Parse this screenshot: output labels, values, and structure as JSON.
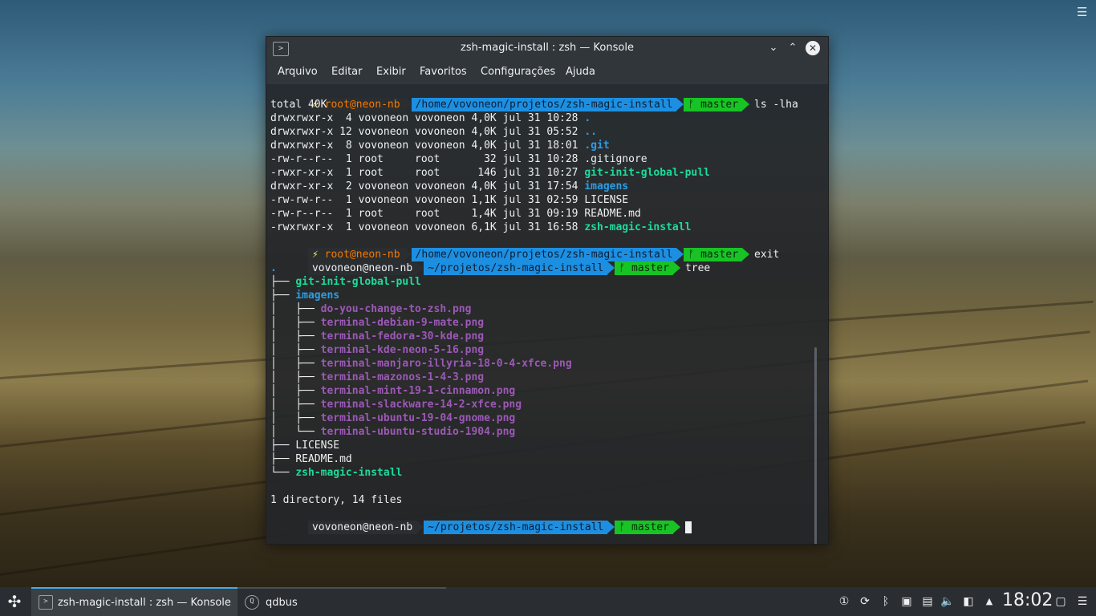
{
  "desktop": {
    "menu_icon": "hamburger-icon"
  },
  "window": {
    "title": "zsh-magic-install : zsh — Konsole",
    "icon": "terminal-icon",
    "controls": {
      "minimize": "⌄",
      "maximize": "⌃",
      "close": "✕"
    },
    "menu": [
      "Arquivo",
      "Editar",
      "Exibir",
      "Favoritos",
      "Configurações",
      "Ajuda"
    ]
  },
  "terminal": {
    "prompt1": {
      "bolt": "⚡",
      "user": "root@neon-nb",
      "path": "/home/vovoneon/projetos/zsh-magic-install",
      "git": "ᚠ master",
      "command": "ls -lha"
    },
    "total": "total 40K",
    "ls_rows": [
      {
        "meta": "drwxrwxr-x  4 vovoneon vovoneon 4,0K jul 31 10:28 ",
        "name": ".",
        "style": "blue"
      },
      {
        "meta": "drwxrwxr-x 12 vovoneon vovoneon 4,0K jul 31 05:52 ",
        "name": "..",
        "style": "blue"
      },
      {
        "meta": "drwxrwxr-x  8 vovoneon vovoneon 4,0K jul 31 18:01 ",
        "name": ".git",
        "style": "blue"
      },
      {
        "meta": "-rw-r--r--  1 root     root       32 jul 31 10:28 ",
        "name": ".gitignore",
        "style": "white"
      },
      {
        "meta": "-rwxr-xr-x  1 root     root      146 jul 31 10:27 ",
        "name": "git-init-global-pull",
        "style": "green"
      },
      {
        "meta": "drwxr-xr-x  2 vovoneon vovoneon 4,0K jul 31 17:54 ",
        "name": "imagens",
        "style": "blue"
      },
      {
        "meta": "-rw-rw-r--  1 vovoneon vovoneon 1,1K jul 31 02:59 ",
        "name": "LICENSE",
        "style": "white"
      },
      {
        "meta": "-rw-r--r--  1 root     root     1,4K jul 31 09:19 ",
        "name": "README.md",
        "style": "white"
      },
      {
        "meta": "-rwxrwxr-x  1 vovoneon vovoneon 6,1K jul 31 16:58 ",
        "name": "zsh-magic-install",
        "style": "green"
      }
    ],
    "prompt2": {
      "bolt": "⚡",
      "user": "root@neon-nb",
      "path": "/home/vovoneon/projetos/zsh-magic-install",
      "git": "ᚠ master",
      "command": "exit"
    },
    "prompt3": {
      "user": "vovoneon@neon-nb",
      "path": "~/projetos/zsh-magic-install",
      "git": "ᚠ master",
      "command": "tree"
    },
    "tree": [
      {
        "prefix": "",
        "name": ".",
        "style": "blue"
      },
      {
        "prefix": "├── ",
        "name": "git-init-global-pull",
        "style": "green"
      },
      {
        "prefix": "├── ",
        "name": "imagens",
        "style": "blue"
      },
      {
        "prefix": "│   ├── ",
        "name": "do-you-change-to-zsh.png",
        "style": "purple"
      },
      {
        "prefix": "│   ├── ",
        "name": "terminal-debian-9-mate.png",
        "style": "purple"
      },
      {
        "prefix": "│   ├── ",
        "name": "terminal-fedora-30-kde.png",
        "style": "purple"
      },
      {
        "prefix": "│   ├── ",
        "name": "terminal-kde-neon-5-16.png",
        "style": "purple"
      },
      {
        "prefix": "│   ├── ",
        "name": "terminal-manjaro-illyria-18-0-4-xfce.png",
        "style": "purple"
      },
      {
        "prefix": "│   ├── ",
        "name": "terminal-mazonos-1-4-3.png",
        "style": "purple"
      },
      {
        "prefix": "│   ├── ",
        "name": "terminal-mint-19-1-cinnamon.png",
        "style": "purple"
      },
      {
        "prefix": "│   ├── ",
        "name": "terminal-slackware-14-2-xfce.png",
        "style": "purple"
      },
      {
        "prefix": "│   ├── ",
        "name": "terminal-ubuntu-19-04-gnome.png",
        "style": "purple"
      },
      {
        "prefix": "│   └── ",
        "name": "terminal-ubuntu-studio-1904.png",
        "style": "purple"
      },
      {
        "prefix": "├── ",
        "name": "LICENSE",
        "style": "white"
      },
      {
        "prefix": "├── ",
        "name": "README.md",
        "style": "white"
      },
      {
        "prefix": "└── ",
        "name": "zsh-magic-install",
        "style": "green"
      }
    ],
    "summary": "1 directory, 14 files",
    "prompt4": {
      "user": "vovoneon@neon-nb",
      "path": "~/projetos/zsh-magic-install",
      "git": "ᚠ master",
      "command": ""
    }
  },
  "taskbar": {
    "launcher_icon": "plasma-launcher-icon",
    "tasks": [
      {
        "label": "zsh-magic-install : zsh — Konsole",
        "icon": "konsole-icon",
        "active": true
      },
      {
        "label": "qdbus",
        "icon": "qdbus-icon",
        "active": false
      }
    ],
    "tray": [
      {
        "icon": "notifications-icon",
        "glyph": "①"
      },
      {
        "icon": "updates-icon",
        "glyph": "⟳"
      },
      {
        "icon": "bluetooth-icon",
        "glyph": "ᛒ"
      },
      {
        "icon": "network-icon",
        "glyph": "▣"
      },
      {
        "icon": "clipboard-icon",
        "glyph": "▤"
      },
      {
        "icon": "volume-icon",
        "glyph": "🔈"
      },
      {
        "icon": "device-icon",
        "glyph": "◧"
      },
      {
        "icon": "expand-tray-icon",
        "glyph": "▲"
      }
    ],
    "clock": "18:02",
    "show_desktop_icon": "show-desktop-icon",
    "settings_icon": "panel-settings-icon"
  }
}
